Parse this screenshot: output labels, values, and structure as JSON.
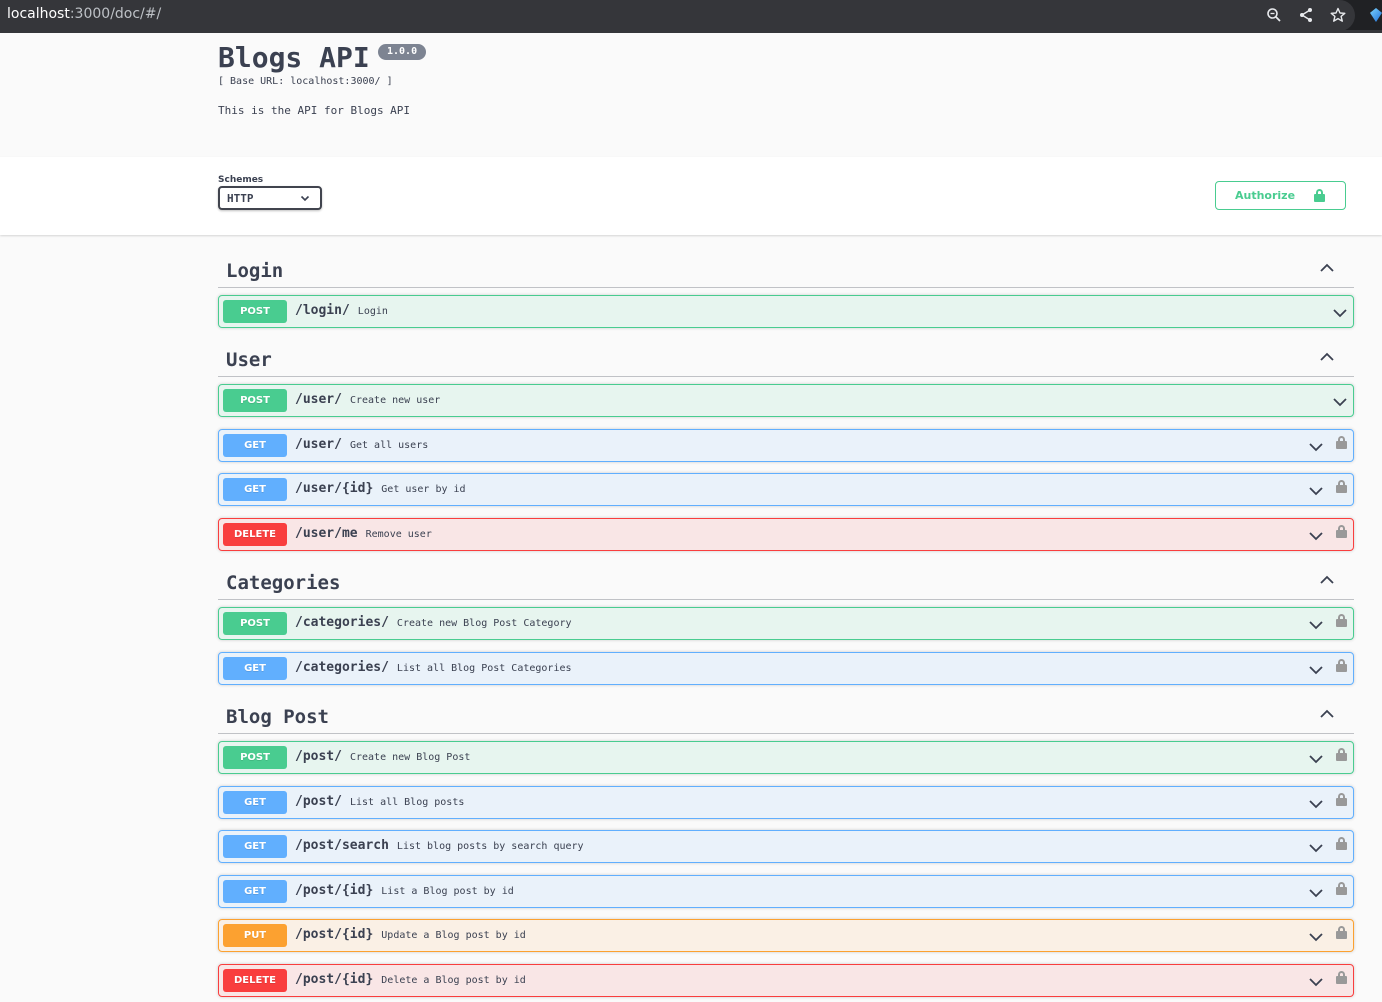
{
  "browser": {
    "url_host": "localhost",
    "url_rest": ":3000/doc/#/",
    "icons": [
      "zoom-icon",
      "share-icon",
      "star-icon",
      "extension-icon"
    ]
  },
  "info": {
    "title": "Blogs API",
    "version": "1.0.0",
    "base_url": "[ Base URL: localhost:3000/ ]",
    "description": "This is the API for Blogs API"
  },
  "schemes": {
    "label": "Schemes",
    "selected": "HTTP",
    "authorize_label": "Authorize"
  },
  "colors": {
    "post": "#49cc90",
    "get": "#61affe",
    "delete": "#f93e3e",
    "put": "#fca130",
    "text": "#3b4151"
  },
  "tags": [
    {
      "name": "Login",
      "operations": [
        {
          "method": "POST",
          "path": "/login/",
          "summary": "Login",
          "locked": false
        }
      ]
    },
    {
      "name": "User",
      "operations": [
        {
          "method": "POST",
          "path": "/user/",
          "summary": "Create new user",
          "locked": false
        },
        {
          "method": "GET",
          "path": "/user/",
          "summary": "Get all users",
          "locked": true
        },
        {
          "method": "GET",
          "path": "/user/{id}",
          "summary": "Get user by id",
          "locked": true
        },
        {
          "method": "DELETE",
          "path": "/user/me",
          "summary": "Remove user",
          "locked": true
        }
      ]
    },
    {
      "name": "Categories",
      "operations": [
        {
          "method": "POST",
          "path": "/categories/",
          "summary": "Create new Blog Post Category",
          "locked": true
        },
        {
          "method": "GET",
          "path": "/categories/",
          "summary": "List all Blog Post Categories",
          "locked": true
        }
      ]
    },
    {
      "name": "Blog Post",
      "operations": [
        {
          "method": "POST",
          "path": "/post/",
          "summary": "Create new Blog Post",
          "locked": true
        },
        {
          "method": "GET",
          "path": "/post/",
          "summary": "List all Blog posts",
          "locked": true
        },
        {
          "method": "GET",
          "path": "/post/search",
          "summary": "List blog posts by search query",
          "locked": true
        },
        {
          "method": "GET",
          "path": "/post/{id}",
          "summary": "List a Blog post by id",
          "locked": true
        },
        {
          "method": "PUT",
          "path": "/post/{id}",
          "summary": "Update a Blog post by id",
          "locked": true
        },
        {
          "method": "DELETE",
          "path": "/post/{id}",
          "summary": "Delete a Blog post by id",
          "locked": true
        }
      ]
    }
  ]
}
